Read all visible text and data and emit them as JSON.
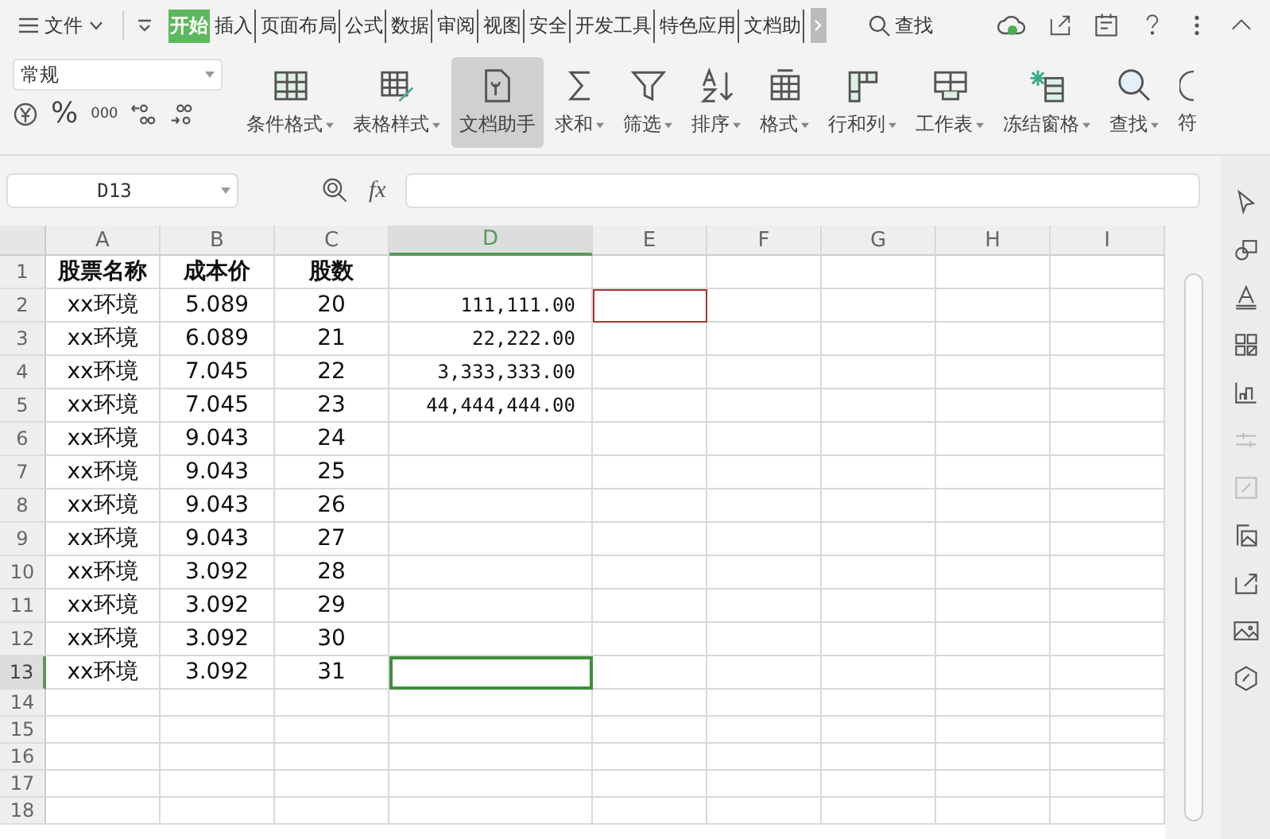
{
  "menu_bar": {
    "file_menu": "文件",
    "tabs": [
      {
        "label": "开始",
        "selected": true
      },
      {
        "label": "插入",
        "selected": false
      },
      {
        "label": "页面布局",
        "selected": false
      },
      {
        "label": "公式",
        "selected": false
      },
      {
        "label": "数据",
        "selected": false
      },
      {
        "label": "审阅",
        "selected": false
      },
      {
        "label": "视图",
        "selected": false
      },
      {
        "label": "安全",
        "selected": false
      },
      {
        "label": "开发工具",
        "selected": false
      },
      {
        "label": "特色应用",
        "selected": false
      },
      {
        "label": "文档助",
        "selected": false
      }
    ],
    "search_label": "查找"
  },
  "ribbon": {
    "number_format": "常规",
    "percent_label": "%",
    "thousands_label": "000",
    "tools": [
      {
        "kind": "conditional",
        "label": "条件格式",
        "dropdown": true,
        "selected": false
      },
      {
        "kind": "table-style",
        "label": "表格样式",
        "dropdown": true,
        "selected": false
      },
      {
        "kind": "assistant",
        "label": "文档助手",
        "dropdown": false,
        "selected": true
      },
      {
        "kind": "sum",
        "label": "求和",
        "dropdown": true,
        "selected": false
      },
      {
        "kind": "filter",
        "label": "筛选",
        "dropdown": true,
        "selected": false
      },
      {
        "kind": "sort",
        "label": "排序",
        "dropdown": true,
        "selected": false
      },
      {
        "kind": "format",
        "label": "格式",
        "dropdown": true,
        "selected": false
      },
      {
        "kind": "rows-cols",
        "label": "行和列",
        "dropdown": true,
        "selected": false
      },
      {
        "kind": "sheet",
        "label": "工作表",
        "dropdown": true,
        "selected": false
      },
      {
        "kind": "freeze",
        "label": "冻结窗格",
        "dropdown": true,
        "selected": false
      },
      {
        "kind": "find",
        "label": "查找",
        "dropdown": true,
        "selected": false
      },
      {
        "kind": "symbol",
        "label": "符",
        "dropdown": false,
        "selected": false
      }
    ]
  },
  "formula_bar": {
    "name_box": "D13",
    "fx_label": "fx"
  },
  "sheet": {
    "columns": [
      {
        "label": "A",
        "selected": false
      },
      {
        "label": "B",
        "selected": false
      },
      {
        "label": "C",
        "selected": false
      },
      {
        "label": "D",
        "selected": true
      },
      {
        "label": "E",
        "selected": false
      },
      {
        "label": "F",
        "selected": false
      },
      {
        "label": "G",
        "selected": false
      },
      {
        "label": "H",
        "selected": false
      },
      {
        "label": "I",
        "selected": false
      }
    ],
    "rows": [
      {
        "label": "1",
        "selected": false,
        "kind": "header",
        "cells": [
          "股票名称",
          "成本价",
          "股数"
        ]
      },
      {
        "label": "2",
        "selected": false,
        "cells": [
          "xx环境",
          "5.089",
          "20",
          "111,111.00",
          {
            "outlined": true
          }
        ]
      },
      {
        "label": "3",
        "selected": false,
        "cells": [
          "xx环境",
          "6.089",
          "21",
          "22,222.00"
        ]
      },
      {
        "label": "4",
        "selected": false,
        "cells": [
          "xx环境",
          "7.045",
          "22",
          "3,333,333.00"
        ]
      },
      {
        "label": "5",
        "selected": false,
        "cells": [
          "xx环境",
          "7.045",
          "23",
          "44,444,444.00"
        ]
      },
      {
        "label": "6",
        "selected": false,
        "cells": [
          "xx环境",
          "9.043",
          "24"
        ]
      },
      {
        "label": "7",
        "selected": false,
        "cells": [
          "xx环境",
          "9.043",
          "25"
        ]
      },
      {
        "label": "8",
        "selected": false,
        "cells": [
          "xx环境",
          "9.043",
          "26"
        ]
      },
      {
        "label": "9",
        "selected": false,
        "cells": [
          "xx环境",
          "9.043",
          "27"
        ]
      },
      {
        "label": "10",
        "selected": false,
        "cells": [
          "xx环境",
          "3.092",
          "28"
        ]
      },
      {
        "label": "11",
        "selected": false,
        "cells": [
          "xx环境",
          "3.092",
          "29"
        ]
      },
      {
        "label": "12",
        "selected": false,
        "cells": [
          "xx环境",
          "3.092",
          "30"
        ]
      },
      {
        "label": "13",
        "selected": true,
        "cells": [
          "xx环境",
          "3.092",
          "31"
        ]
      },
      {
        "label": "14",
        "selected": false
      },
      {
        "label": "15",
        "selected": false
      },
      {
        "label": "16",
        "selected": false
      },
      {
        "label": "17",
        "selected": false
      },
      {
        "label": "18",
        "selected": false
      }
    ]
  },
  "side_panel": [
    {
      "kind": "cursor",
      "disabled": false
    },
    {
      "kind": "shapes",
      "disabled": false
    },
    {
      "kind": "text-style",
      "disabled": false
    },
    {
      "kind": "grid",
      "disabled": false
    },
    {
      "kind": "chart",
      "disabled": false
    },
    {
      "kind": "sliders",
      "disabled": true
    },
    {
      "kind": "frame",
      "disabled": true
    },
    {
      "kind": "gallery",
      "disabled": false
    },
    {
      "kind": "share",
      "disabled": false
    },
    {
      "kind": "image",
      "disabled": false
    },
    {
      "kind": "badge",
      "disabled": false
    }
  ]
}
